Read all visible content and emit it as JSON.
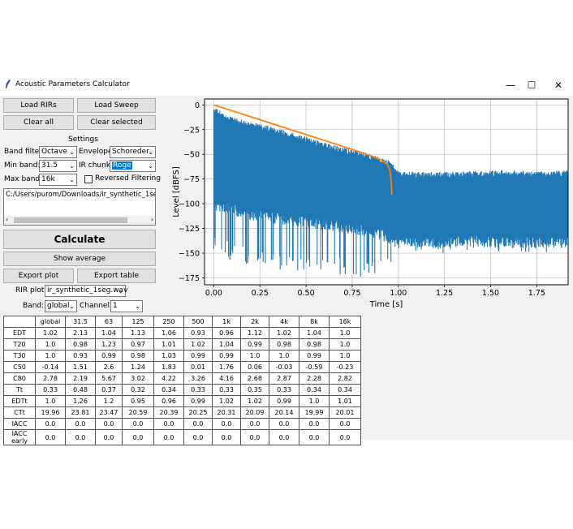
{
  "window": {
    "title": "Acoustic Parameters Calculator",
    "minimize": "—",
    "maximize": "☐",
    "close": "✕"
  },
  "buttons": {
    "load_rirs": "Load RIRs",
    "load_sweep": "Load Sweep",
    "clear_all": "Clear all",
    "clear_selected": "Clear selected",
    "calculate": "Calculate",
    "show_average": "Show average",
    "export_plot": "Export plot",
    "export_table": "Export table"
  },
  "settings": {
    "heading": "Settings",
    "band_filter_label": "Band filter:",
    "band_filter_value": "Octave",
    "envelope_label": "Envelope:",
    "envelope_value": "Schoreder",
    "min_band_label": "Min band:",
    "min_band_value": "31.5",
    "ir_chunk_label": "IR chunk:",
    "ir_chunk_value": "Roge",
    "max_band_label": "Max band:",
    "max_band_value": "16k",
    "reversed_filtering_label": "Reversed Filtering",
    "reversed_filtering_checked": false
  },
  "file_path": "C:/Users/purom/Downloads/ir_synthetic_1seg.",
  "rir_plot": {
    "label": "RIR plot:",
    "value": "ir_synthetic_1seg.wav"
  },
  "band": {
    "label": "Band:",
    "value": "global"
  },
  "channel": {
    "label": "Channel:",
    "value": "1"
  },
  "table": {
    "headers": [
      "",
      "global",
      "31.5",
      "63",
      "125",
      "250",
      "500",
      "1k",
      "2k",
      "4k",
      "8k",
      "16k"
    ],
    "rows": [
      [
        "EDT",
        "1.02",
        "2.13",
        "1.04",
        "1.13",
        "1.06",
        "0.93",
        "0.96",
        "1.12",
        "1.02",
        "1.04",
        "1.0"
      ],
      [
        "T20",
        "1.0",
        "0.98",
        "1.23",
        "0.97",
        "1.01",
        "1.02",
        "1.04",
        "0.99",
        "0.98",
        "0.98",
        "1.0"
      ],
      [
        "T30",
        "1.0",
        "0.93",
        "0.99",
        "0.98",
        "1.03",
        "0.99",
        "0.99",
        "1.0",
        "1.0",
        "0.99",
        "1.0"
      ],
      [
        "C50",
        "-0.14",
        "1.51",
        "2.6",
        "1.24",
        "1.83",
        "0.01",
        "1.76",
        "0.06",
        "-0.03",
        "-0.59",
        "-0.23"
      ],
      [
        "C80",
        "2.78",
        "2.19",
        "5.67",
        "3.02",
        "4.22",
        "3.26",
        "4.16",
        "2.68",
        "2.87",
        "2.28",
        "2.82"
      ],
      [
        "Tt",
        "0.33",
        "0.48",
        "0.37",
        "0.32",
        "0.34",
        "0.33",
        "0.33",
        "0.35",
        "0.33",
        "0.34",
        "0.34"
      ],
      [
        "EDTt",
        "1.0",
        "1.26",
        "1.2",
        "0.95",
        "0.96",
        "0.99",
        "1.02",
        "1.02",
        "0.99",
        "1.0",
        "1.01"
      ],
      [
        "CTt",
        "19.96",
        "23.81",
        "23.47",
        "20.59",
        "20.39",
        "20.25",
        "20.31",
        "20.09",
        "20.14",
        "19.99",
        "20.01"
      ],
      [
        "IACC",
        "0.0",
        "0.0",
        "0.0",
        "0.0",
        "0.0",
        "0.0",
        "0.0",
        "0.0",
        "0.0",
        "0.0",
        "0.0"
      ],
      [
        "IACC early",
        "0.0",
        "0.0",
        "0.0",
        "0.0",
        "0.0",
        "0.0",
        "0.0",
        "0.0",
        "0.0",
        "0.0",
        "0.0"
      ]
    ]
  },
  "chart_data": {
    "type": "line",
    "xlabel": "Time [s]",
    "ylabel": "Level [dBFS]",
    "xlim": [
      -0.05,
      1.92
    ],
    "ylim": [
      -182,
      6
    ],
    "xticks": [
      0.0,
      0.25,
      0.5,
      0.75,
      1.0,
      1.25,
      1.5,
      1.75
    ],
    "xtick_labels": [
      "0.00",
      "0.25",
      "0.50",
      "0.75",
      "1.00",
      "1.25",
      "1.50",
      "1.75"
    ],
    "yticks": [
      0,
      -25,
      -50,
      -75,
      -100,
      -125,
      -150,
      -175
    ],
    "ytick_labels": [
      "0",
      "−25",
      "−50",
      "−75",
      "−100",
      "−125",
      "−150",
      "−175"
    ],
    "series": [
      {
        "color": "#1f77b4",
        "kind": "envelope-fill",
        "x": [
          0.0,
          0.1,
          0.2,
          0.3,
          0.4,
          0.5,
          0.6,
          0.7,
          0.8,
          0.9,
          0.96,
          1.0,
          1.2,
          1.4,
          1.6,
          1.8,
          1.92
        ],
        "upper": [
          -2,
          -12,
          -17,
          -21,
          -27,
          -32,
          -38,
          -43,
          -47,
          -53,
          -57,
          -67,
          -68,
          -67,
          -66,
          -67,
          -66
        ],
        "lower": [
          -95,
          -100,
          -105,
          -108,
          -110,
          -112,
          -115,
          -118,
          -120,
          -125,
          -130,
          -133,
          -133,
          -132,
          -133,
          -133,
          -133
        ],
        "min_spikes": [
          -150,
          -158,
          -163,
          -165,
          -168,
          -170,
          -170,
          -172,
          -176,
          -173,
          -160,
          -148,
          -150,
          -149,
          -151,
          -150,
          -149
        ]
      },
      {
        "color": "#ff7f0e",
        "kind": "line",
        "x": [
          0.0,
          0.2,
          0.4,
          0.6,
          0.8,
          0.9,
          0.94,
          0.955,
          0.96,
          0.965
        ],
        "y": [
          0,
          -12,
          -24,
          -36,
          -48,
          -55,
          -60,
          -66,
          -75,
          -91
        ]
      }
    ]
  }
}
